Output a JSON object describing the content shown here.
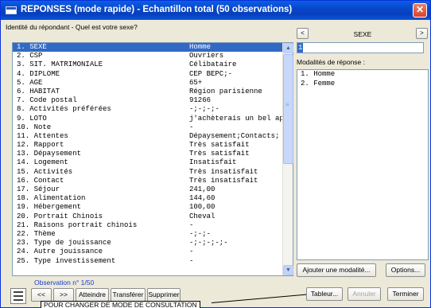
{
  "window": {
    "title": "REPONSES (mode rapide) - Echantillon total (50 observations)",
    "close_label": "✕"
  },
  "question": "Identité du répondant - Quel est votre sexe?",
  "list": {
    "rows": [
      {
        "label": "1. SEXE",
        "value": "Homme"
      },
      {
        "label": "2. CSP",
        "value": "Ouvriers"
      },
      {
        "label": "3. SIT. MATRIMONIALE",
        "value": "Célibataire"
      },
      {
        "label": "4. DIPLOME",
        "value": "CEP BEPC;-"
      },
      {
        "label": "5. AGE",
        "value": "65+"
      },
      {
        "label": "6. HABITAT",
        "value": "Région parisienne"
      },
      {
        "label": "7. Code postal",
        "value": "91266"
      },
      {
        "label": "8. Activités préférées",
        "value": "-;-;-;-"
      },
      {
        "label": "9. LOTO",
        "value": "j'achèterais un bel appartement"
      },
      {
        "label": "10. Note",
        "value": "-"
      },
      {
        "label": "11. Attentes",
        "value": "Dépaysement;Contacts;"
      },
      {
        "label": "12. Rapport",
        "value": "Très satisfait"
      },
      {
        "label": "13. Dépaysement",
        "value": "Très satisfait"
      },
      {
        "label": "14. Logement",
        "value": "Insatisfait"
      },
      {
        "label": "15. Activités",
        "value": "Très insatisfait"
      },
      {
        "label": "16. Contact",
        "value": "Très insatisfait"
      },
      {
        "label": "17. Séjour",
        "value": "241,00"
      },
      {
        "label": "18. Alimentation",
        "value": "144,60"
      },
      {
        "label": "19. Hébergement",
        "value": "100,00"
      },
      {
        "label": "20. Portrait Chinois",
        "value": "Cheval"
      },
      {
        "label": "21. Raisons portrait chinois",
        "value": "-"
      },
      {
        "label": "22. Thème",
        "value": "-;-;-"
      },
      {
        "label": "23. Type de jouissance",
        "value": "-;-;-;-;-"
      },
      {
        "label": "24. Autre jouissance",
        "value": "-"
      },
      {
        "label": "25. Type investissement",
        "value": "-"
      }
    ],
    "selected_index": 0,
    "scroll": {
      "up_glyph": "▲",
      "down_glyph": "▼"
    }
  },
  "observation_label": "Observation n° 1/50",
  "toolbar": {
    "prev_label": "<<",
    "next_label": ">>",
    "reach_label": "Atteindre",
    "transfer_label": "Transférer",
    "delete_label": "Supprimer",
    "table_label": "Tableur...",
    "cancel_label": "Annuler",
    "finish_label": "Terminer"
  },
  "tooltip": "POUR CHANGER DE MODE DE CONSULTATION",
  "right_panel": {
    "prev_label": "<",
    "next_label": ">",
    "variable_name": "SEXE",
    "variable_number": "1",
    "modalities_title": "Modalités de réponse :",
    "modalities": [
      "1. Homme",
      "2. Femme"
    ],
    "add_modality_label": "Ajouter une modalité...",
    "options_label": "Options..."
  }
}
